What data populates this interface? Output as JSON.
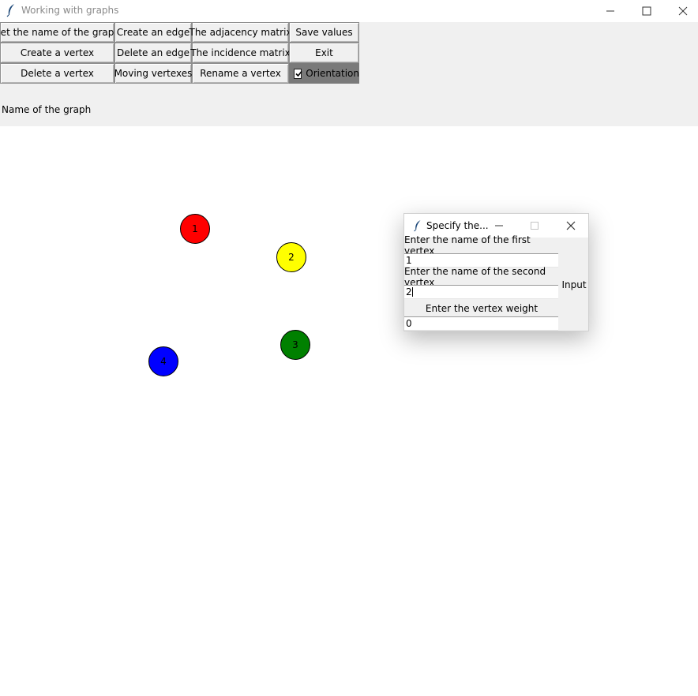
{
  "window": {
    "title": "Working with graphs"
  },
  "toolbar": {
    "set_name": "Set the name of the graph",
    "create_edge": "Create an edge",
    "adjacency_matrix": "The adjacency matrix",
    "save_values": "Save values",
    "create_vertex": "Create a vertex",
    "delete_edge": "Delete an edge",
    "incidence_matrix": "The incidence matrix",
    "exit": "Exit",
    "delete_vertex": "Delete a vertex",
    "moving_vertexes": "Moving vertexes",
    "rename_vertex": "Rename a vertex",
    "orientation": {
      "label": "Orientation",
      "checked": true
    }
  },
  "graph_name_label": "Name of the graph",
  "vertices": [
    {
      "label": "1",
      "color": "#ff0000"
    },
    {
      "label": "2",
      "color": "#ffff00"
    },
    {
      "label": "3",
      "color": "#008000"
    },
    {
      "label": "4",
      "color": "#0000ff"
    }
  ],
  "dialog": {
    "title": "Specify the...",
    "first_vertex_label": "Enter the name of the first vertex",
    "first_vertex_value": "1",
    "second_vertex_label": "Enter the name of the second vertex",
    "second_vertex_value": "2",
    "weight_label": "Enter the vertex weight",
    "weight_value": "0",
    "input_button": "Input"
  }
}
